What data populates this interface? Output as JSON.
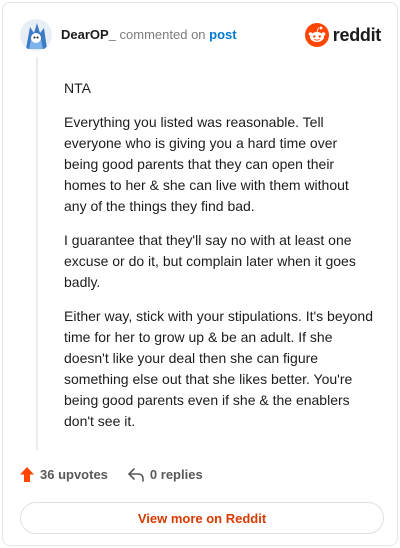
{
  "header": {
    "username": "DearOP_",
    "action_text": "commented on",
    "post_link": "post",
    "brand_name": "reddit",
    "brand_color": "#ff4500"
  },
  "comment": {
    "paragraphs": [
      "NTA",
      "Everything you listed was reasonable. Tell everyone who is giving you a hard time over being good parents that they can open their homes to her & she can live with them without any of the things they find bad.",
      "I guarantee that they'll say no with at least one excuse or do it, but complain later when it goes badly.",
      "Either way, stick with your stipulations. It's beyond time for her to grow up & be an adult. If she doesn't like your deal then she can figure something else out that she likes better. You're being good parents even if she & the enablers don't see it."
    ]
  },
  "footer": {
    "upvotes_label": "36 upvotes",
    "replies_label": "0 replies",
    "upvote_icon": "upvote-arrow-icon",
    "reply_icon": "reply-arrow-icon"
  },
  "view_more_label": "View more on Reddit",
  "accent_color": "#d93a00"
}
